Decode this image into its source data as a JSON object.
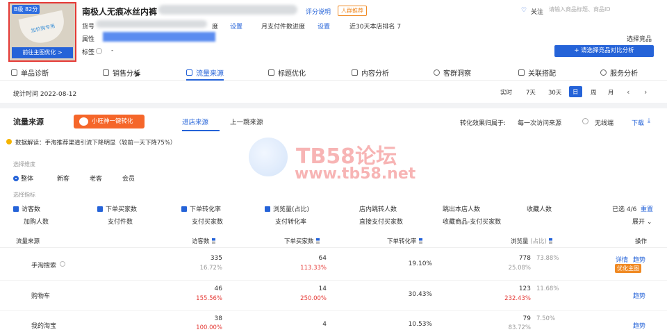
{
  "product": {
    "grade": "B级 82分",
    "thumb_text": "加价购专用",
    "optimize_btn": "前往主图优化 >",
    "title": "南极人无痕冰丝内裤",
    "rating_link": "评分说明",
    "crowd_btn": "人群推荐",
    "sku_label": "货号",
    "progress_label": "度",
    "setting1": "设置",
    "monthly_label": "月支付件数进度",
    "setting2": "设置",
    "rank_label": "近30天本店排名 7",
    "attr_label": "属性",
    "tag_label": "标签",
    "tag_value": "-"
  },
  "header": {
    "follow": "关注",
    "search_placeholder": "请输入商品标题、商品ID",
    "choose_competitor": "选择竞品",
    "compare_btn": "+ 请选择竞品对比分析"
  },
  "nav": [
    {
      "label": "单品诊断",
      "icon": "diagnose-icon"
    },
    {
      "label": "销售分析",
      "icon": "bag-icon"
    },
    {
      "label": "流量来源",
      "icon": "chart-icon"
    },
    {
      "label": "标题优化",
      "icon": "title-icon"
    },
    {
      "label": "内容分析",
      "icon": "content-icon"
    },
    {
      "label": "客群洞察",
      "icon": "people-icon"
    },
    {
      "label": "关联搭配",
      "icon": "link-icon"
    },
    {
      "label": "服务分析",
      "icon": "service-icon"
    }
  ],
  "stats_time": "统计时间 2022-08-12",
  "date_ranges": [
    "实时",
    "7天",
    "30天",
    "日",
    "周",
    "月"
  ],
  "traffic": {
    "title": "流量来源",
    "wangwang_btn": "小旺神一键转化",
    "tabs": [
      "进店来源",
      "上一跳来源"
    ],
    "attr_label": "转化效果归属于:",
    "attr_value": "每一次访问来源",
    "wireless": "无线端",
    "download": "下载",
    "insight": "数据解读：手淘推荐渠道引流下降明显（较前一天下降75%）",
    "dim_label": "选择维度",
    "dims": [
      "整体",
      "新客",
      "老客",
      "会员"
    ],
    "metric_label": "选择指标",
    "metrics_row1": [
      {
        "label": "访客数",
        "checked": true
      },
      {
        "label": "下单买家数",
        "checked": true
      },
      {
        "label": "下单转化率",
        "checked": true
      },
      {
        "label": "浏览量(占比)",
        "checked": true
      },
      {
        "label": "店内跳转人数",
        "checked": false
      },
      {
        "label": "跳出本店人数",
        "checked": false
      },
      {
        "label": "收藏人数",
        "checked": false
      }
    ],
    "metrics_row2": [
      "加购人数",
      "支付件数",
      "支付买家数",
      "支付转化率",
      "直接支付买家数",
      "收藏商品-支付买家数"
    ],
    "selected_count": "已选 4/6",
    "reset": "重置",
    "expand": "展开",
    "columns": [
      "流量来源",
      "访客数",
      "下单买家数",
      "下单转化率",
      "浏览量",
      "(占比)",
      "操作"
    ],
    "rows": [
      {
        "name": "手淘搜索",
        "visitors": "335",
        "visitors_sub": "16.72%",
        "buyers": "64",
        "buyers_sub": "113.33%",
        "cvr": "19.10%",
        "pv": "778",
        "pv_share": "73.88%",
        "pv_sub": "25.08%",
        "actions": [
          "详情",
          "趋势"
        ],
        "optimize": "优化主图"
      },
      {
        "name": "购物车",
        "visitors": "46",
        "visitors_sub": "155.56%",
        "buyers": "14",
        "buyers_sub": "250.00%",
        "cvr": "30.43%",
        "pv": "123",
        "pv_share": "11.68%",
        "pv_sub": "232.43%",
        "actions": [
          "趋势"
        ]
      },
      {
        "name": "我的淘宝",
        "visitors": "38",
        "visitors_sub": "100.00%",
        "buyers": "4",
        "buyers_sub": "",
        "cvr": "10.53%",
        "pv": "79",
        "pv_share": "7.50%",
        "pv_sub": "83.72%",
        "actions": [
          "趋势"
        ]
      }
    ]
  },
  "watermark": {
    "line1": "TB58论坛",
    "line2": "www.tb58.net"
  },
  "colors": {
    "accent": "#2563d8",
    "orange": "#f08a24",
    "red": "#e53935"
  }
}
